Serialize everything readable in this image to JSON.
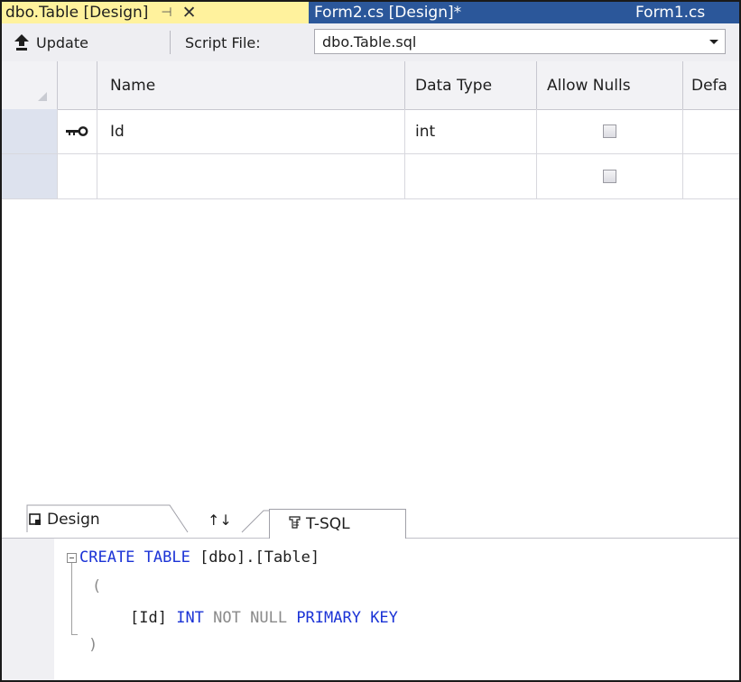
{
  "tabs": {
    "active": "dbo.Table [Design]",
    "pin_glyph": "⊣",
    "close_glyph": "✕",
    "second": "Form2.cs [Design]*",
    "third": "Form1.cs"
  },
  "toolbar": {
    "update_label": "Update",
    "script_file_label": "Script File:",
    "script_file_value": "dbo.Table.sql"
  },
  "grid": {
    "columns": [
      "Name",
      "Data Type",
      "Allow Nulls",
      "Defa"
    ],
    "rows": [
      {
        "name": "Id",
        "data_type": "int",
        "allow_nulls": false,
        "primary_key": true
      },
      {
        "name": "",
        "data_type": "",
        "allow_nulls": false,
        "primary_key": false
      }
    ]
  },
  "bottom_tabs": {
    "design": "Design",
    "swap": "↑↓",
    "tsql": "T-SQL"
  },
  "sql": {
    "line1_kw": "CREATE TABLE",
    "line1_rest": " [dbo].[Table]",
    "line2": "(",
    "line3_col": "[Id]",
    "line3_type": "INT",
    "line3_null": "NOT NULL",
    "line3_pk": "PRIMARY KEY",
    "line4": ")"
  },
  "colors": {
    "tab_strip": "#2b579a",
    "active_tab": "#fff29d",
    "sql_keyword": "#1b33d6",
    "sql_gray": "#8a8a8a"
  },
  "icons": {
    "update": "upload-arrow-icon",
    "primary_key": "key-icon",
    "design": "design-view-icon",
    "tsql": "script-icon"
  }
}
